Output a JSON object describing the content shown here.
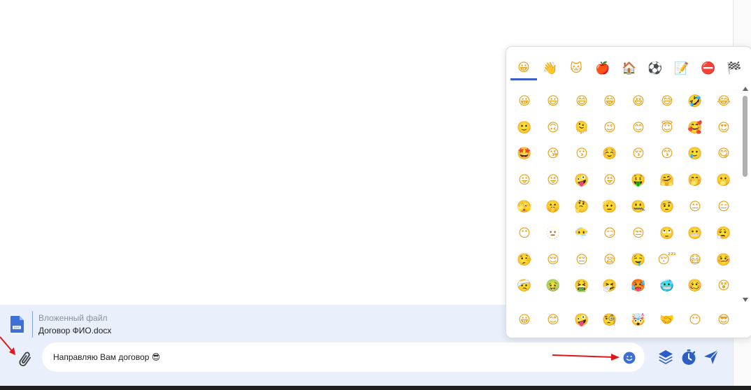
{
  "attachment": {
    "caption": "Вложенный файл",
    "filename": "Договор ФИО.docx",
    "icon": "doc-file-icon"
  },
  "composer": {
    "message_text": "Направляю Вам договор 😎",
    "attach_icon": "paperclip-icon",
    "emoji_icon": "smiley-icon",
    "actions": [
      "layers-icon",
      "timer-icon",
      "send-icon"
    ]
  },
  "emoji_picker": {
    "categories": [
      {
        "name": "smileys",
        "glyph": "😀",
        "active": true
      },
      {
        "name": "people",
        "glyph": "👋"
      },
      {
        "name": "animals",
        "glyph": "🐱"
      },
      {
        "name": "food",
        "glyph": "🍎"
      },
      {
        "name": "places",
        "glyph": "🏠"
      },
      {
        "name": "activities",
        "glyph": "⚽"
      },
      {
        "name": "objects",
        "glyph": "📝"
      },
      {
        "name": "symbols",
        "glyph": "⛔"
      },
      {
        "name": "flags",
        "glyph": "🏁"
      }
    ],
    "emojis": [
      "😀",
      "😃",
      "😄",
      "😁",
      "😆",
      "😅",
      "🤣",
      "😂",
      "🙂",
      "🙃",
      "🫠",
      "😉",
      "😊",
      "😇",
      "🥰",
      "😍",
      "🤩",
      "😘",
      "😗",
      "☺️",
      "😚",
      "😙",
      "🥲",
      "😋",
      "😛",
      "😜",
      "🤪",
      "😝",
      "🤑",
      "🤗",
      "🤭",
      "🫢",
      "🫣",
      "🤫",
      "🤔",
      "🫡",
      "🤐",
      "🤨",
      "😐",
      "😑",
      "😶",
      "🫥",
      "😶‍🌫️",
      "😏",
      "😒",
      "🙄",
      "😬",
      "😮‍💨",
      "🤥",
      "😌",
      "😔",
      "😪",
      "🤤",
      "😴",
      "😷",
      "🤒",
      "🤕",
      "🤢",
      "🤮",
      "🤧",
      "🥵",
      "🥶",
      "🥴",
      "😵"
    ],
    "bottom_row": [
      "😀",
      "😊",
      "🤪",
      "🧐",
      "🤯",
      "🤝",
      "😶",
      "😎"
    ]
  },
  "colors": {
    "accent": "#3b5ec6",
    "composer_bg": "#eaf0fb",
    "annotation_arrow": "#e0161a"
  }
}
